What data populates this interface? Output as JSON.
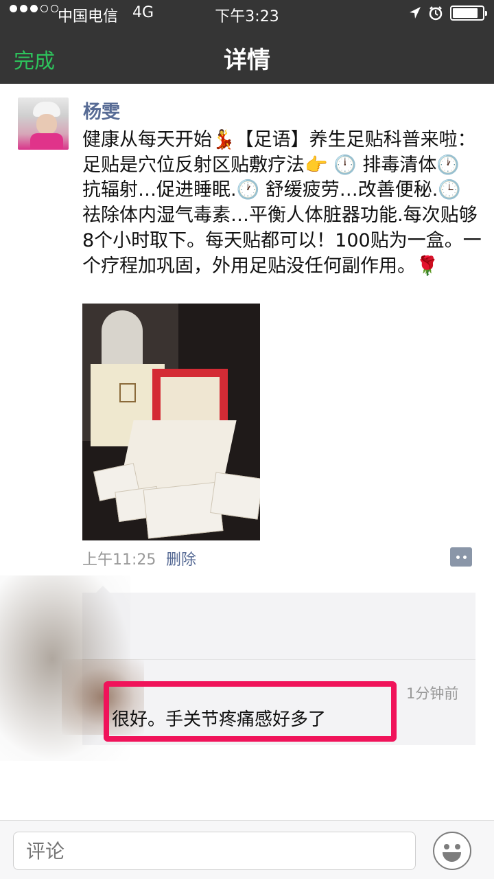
{
  "status_bar": {
    "carrier": "中国电信",
    "network": "4G",
    "time": "下午3:23",
    "signal_filled": 3,
    "signal_total": 5,
    "battery_level": 0.85
  },
  "nav": {
    "done_label": "完成",
    "title": "详情"
  },
  "post": {
    "author": "杨雯",
    "text": "健康从每天开始💃【足语】养生足贴科普来啦： 足贴是穴位反射区贴敷疗法👉 🕛 排毒清体🕐 抗辐射…促进睡眠.🕐 舒缓疲劳…改善便秘.🕒 祛除体内湿气毒素…平衡人体脏器功能.每次贴够8个小时取下。每天贴都可以！100贴为一盒。一个疗程加巩固，外用足贴没任何副作用。🌹",
    "time": "上午11:25",
    "delete_label": "删除"
  },
  "comments": [
    {
      "time": "1分钟前",
      "text": "很好。手关节疼痛感好多了"
    }
  ],
  "bottom_bar": {
    "input_placeholder": "评论"
  },
  "colors": {
    "nav_bg": "#353535",
    "accent_green": "#2dc35c",
    "link_blue": "#576b95",
    "highlight_red": "#f0135a"
  }
}
